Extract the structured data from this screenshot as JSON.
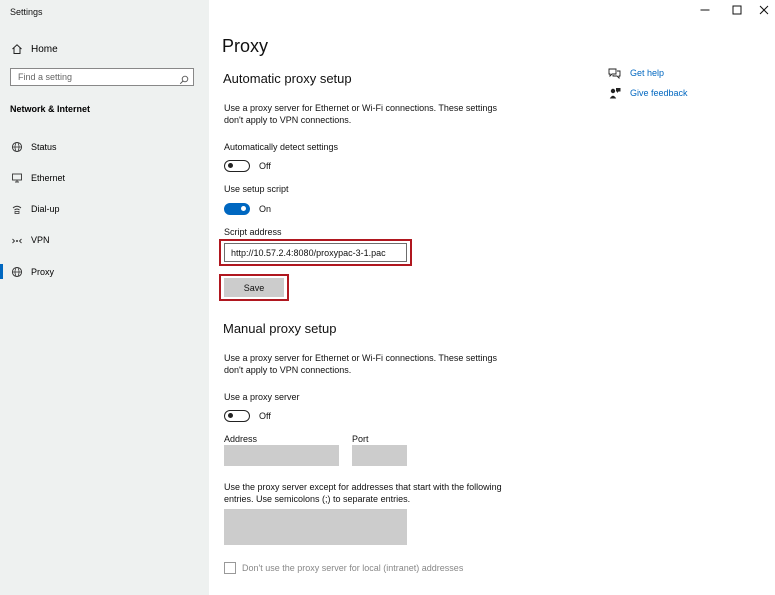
{
  "window": {
    "title": "Settings"
  },
  "sidebar": {
    "home_label": "Home",
    "search_placeholder": "Find a setting",
    "section_heading": "Network & Internet",
    "items": [
      {
        "label": "Status",
        "icon": "globe-icon"
      },
      {
        "label": "Ethernet",
        "icon": "monitor-icon"
      },
      {
        "label": "Dial-up",
        "icon": "dialup-icon"
      },
      {
        "label": "VPN",
        "icon": "vpn-icon"
      },
      {
        "label": "Proxy",
        "icon": "globe-icon",
        "selected": true
      }
    ]
  },
  "main": {
    "title": "Proxy",
    "auto": {
      "heading": "Automatic proxy setup",
      "description": "Use a proxy server for Ethernet or Wi-Fi connections. These settings don't apply to VPN connections.",
      "detect_label": "Automatically detect settings",
      "detect_state": "Off",
      "script_label": "Use setup script",
      "script_state": "On",
      "address_label": "Script address",
      "address_value": "http://10.57.2.4:8080/proxypac-3-1.pac",
      "save_label": "Save"
    },
    "manual": {
      "heading": "Manual proxy setup",
      "description": "Use a proxy server for Ethernet or Wi-Fi connections. These settings don't apply to VPN connections.",
      "use_proxy_label": "Use a proxy server",
      "use_proxy_state": "Off",
      "address_label": "Address",
      "port_label": "Port",
      "exceptions_label": "Use the proxy server except for addresses that start with the following entries. Use semicolons (;) to separate entries.",
      "local_checkbox_label": "Don't use the proxy server for local (intranet) addresses"
    }
  },
  "help": {
    "get_help": "Get help",
    "give_feedback": "Give feedback"
  },
  "colors": {
    "accent": "#0067c0",
    "highlight_border": "#b0171f",
    "sidebar_bg": "#eef1f0"
  }
}
